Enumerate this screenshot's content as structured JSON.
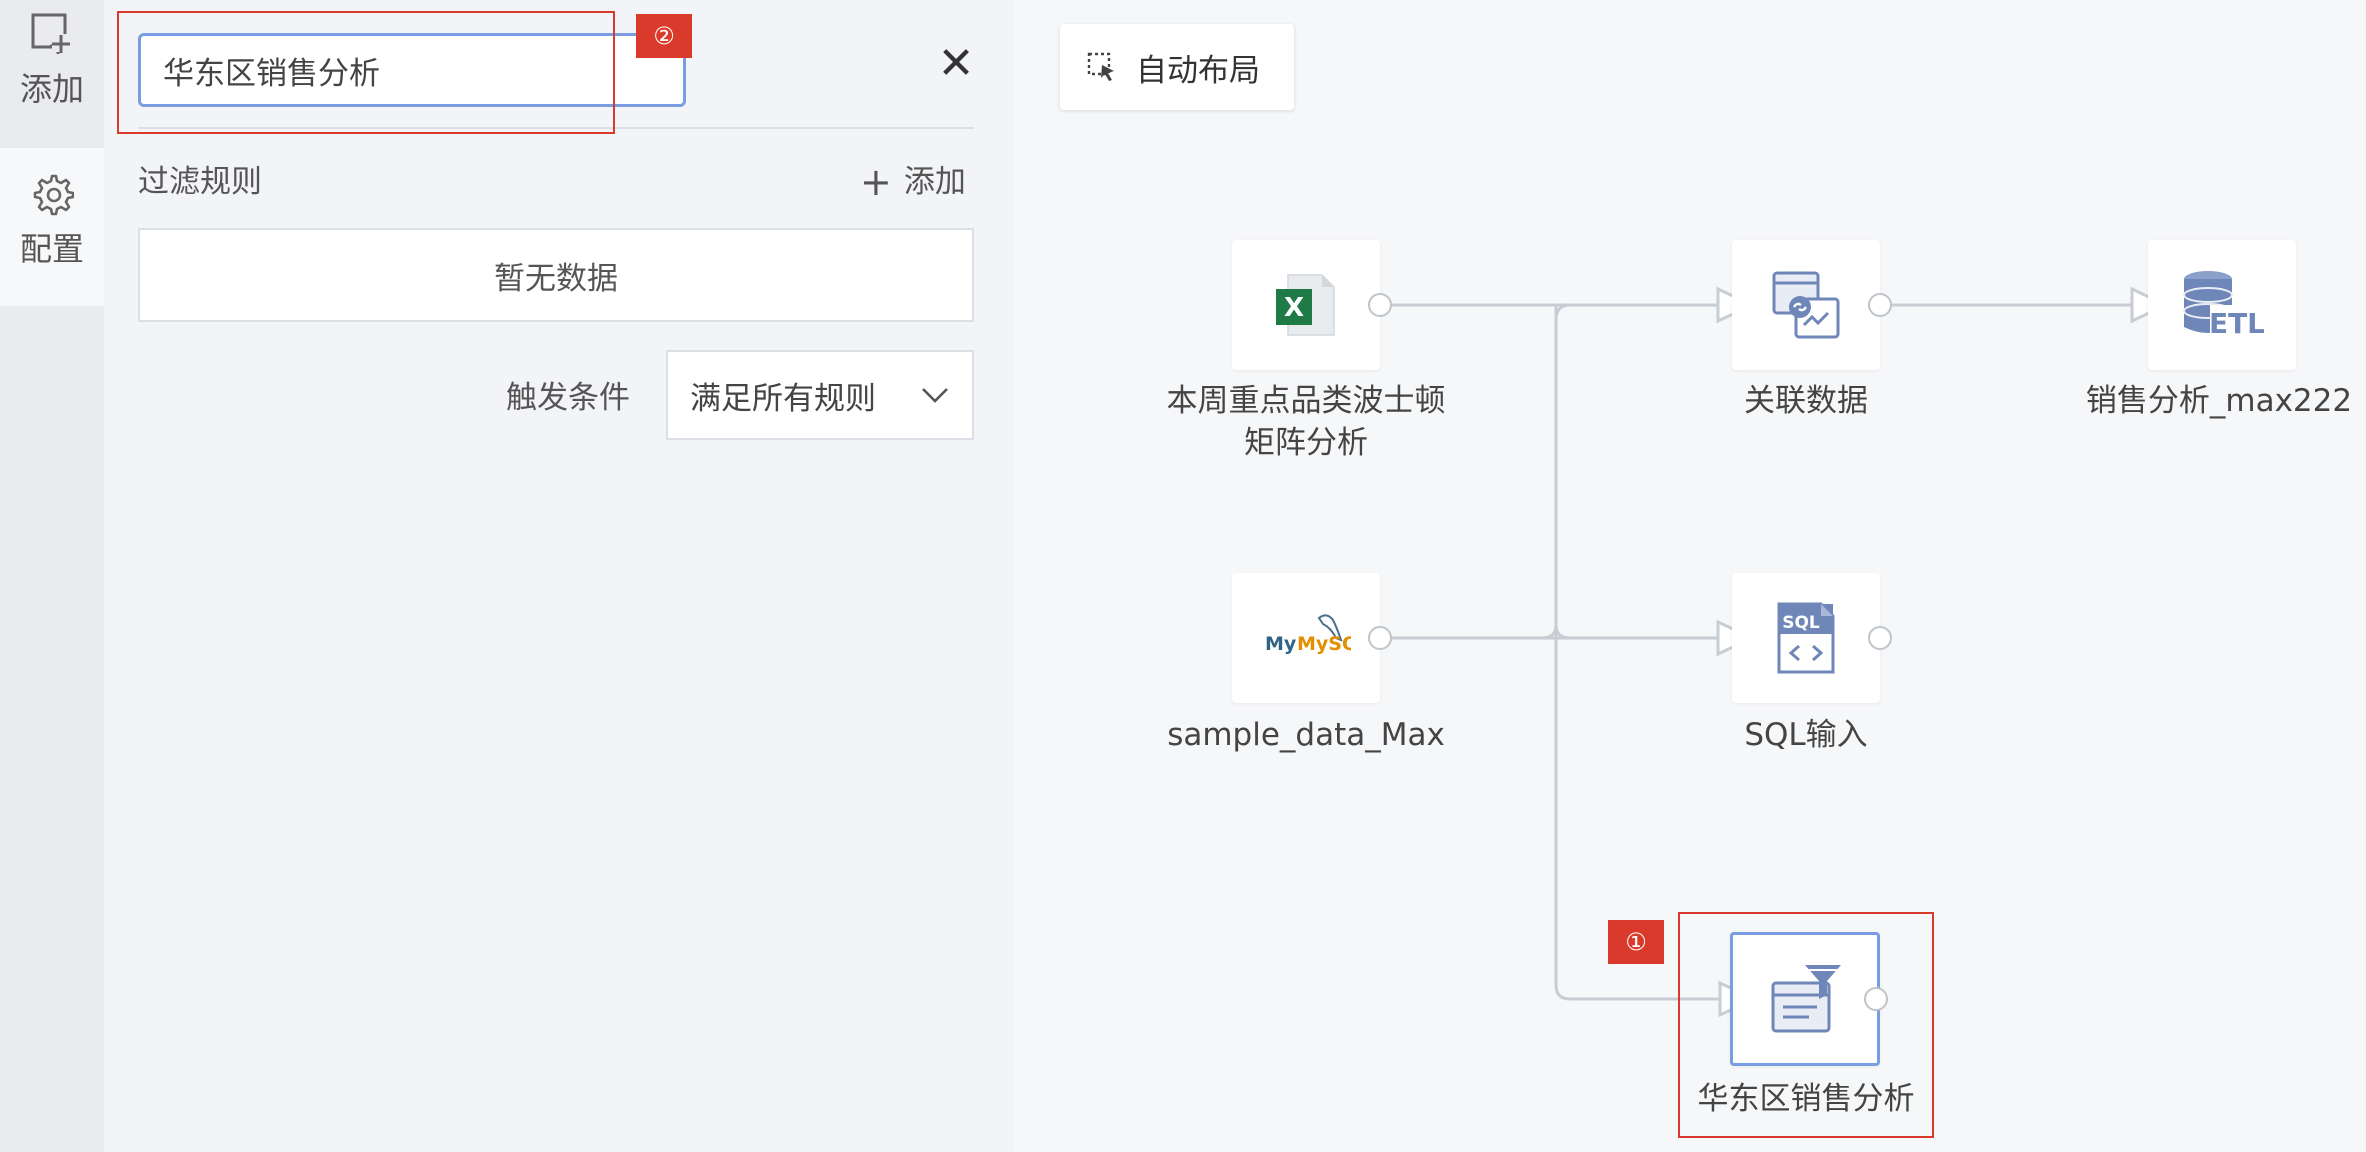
{
  "rail": {
    "add_label": "添加",
    "config_label": "配置"
  },
  "panel": {
    "name_value": "华东区销售分析",
    "rules_label": "过滤规则",
    "rules_add_label": "添加",
    "empty_text": "暂无数据",
    "trigger_label": "触发条件",
    "trigger_value": "满足所有规则"
  },
  "annotations": {
    "badge_1": "①",
    "badge_2": "②"
  },
  "canvas": {
    "auto_layout_label": "自动布局",
    "nodes": {
      "excel": {
        "label_line1": "本周重点品类波士顿",
        "label_line2": "矩阵分析",
        "icon": "excel-icon"
      },
      "mysql": {
        "label": "sample_data_Max",
        "icon": "mysql-icon",
        "logo_text": "MySQL"
      },
      "join": {
        "label": "关联数据",
        "icon": "join-data-icon"
      },
      "sql": {
        "label": "SQL输入",
        "icon": "sql-icon",
        "logo_text": "SQL"
      },
      "etl": {
        "label": "销售分析_max222",
        "icon": "etl-database-icon",
        "logo_text": "ETL"
      },
      "filter": {
        "label": "华东区销售分析",
        "icon": "filter-icon"
      }
    }
  },
  "colors": {
    "accent_blue": "#7a9ce0",
    "annotation_red": "#d93a2b",
    "excel_green": "#1f7a45",
    "icon_blue": "#6f86b8"
  }
}
